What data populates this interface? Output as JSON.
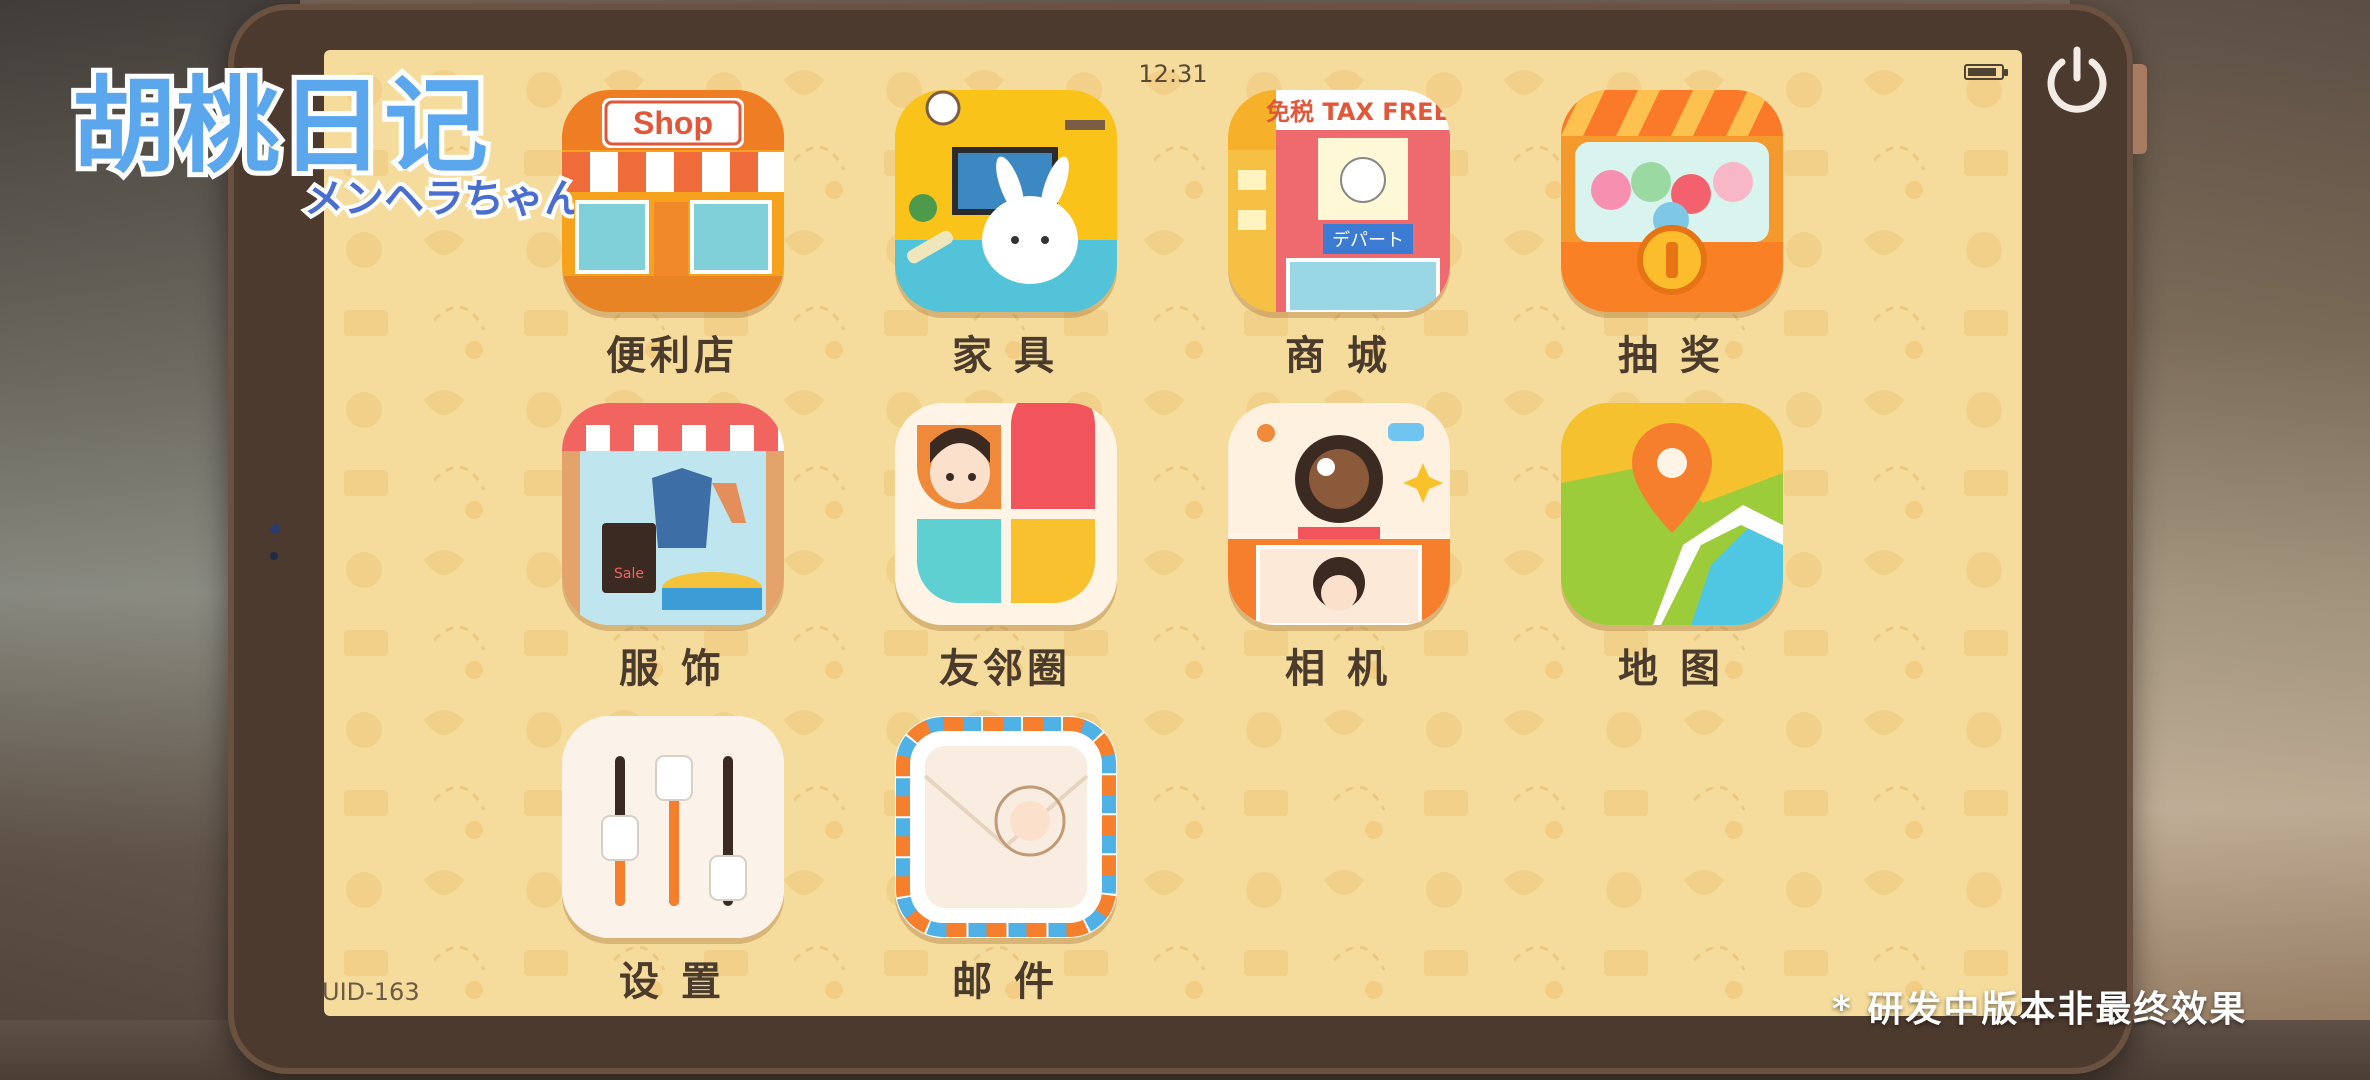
{
  "game": {
    "logo_title": "胡桃日记",
    "logo_subtitle": "メンヘラちゃん"
  },
  "status_bar": {
    "time": "12:31"
  },
  "uid": "UID-163",
  "apps": [
    {
      "label": "便利店",
      "icon": "convenience-store-icon",
      "sign": "Shop"
    },
    {
      "label": "家 具",
      "icon": "furniture-icon"
    },
    {
      "label": "商 城",
      "icon": "mall-icon",
      "sign": "免税 TAX FREE",
      "sign2": "デパート"
    },
    {
      "label": "抽 奖",
      "icon": "lottery-capsule-machine-icon"
    },
    {
      "label": "服 饰",
      "icon": "clothing-store-icon",
      "sign": "Sale"
    },
    {
      "label": "友邻圈",
      "icon": "friends-circle-icon"
    },
    {
      "label": "相 机",
      "icon": "camera-icon"
    },
    {
      "label": "地 图",
      "icon": "map-pin-icon"
    },
    {
      "label": "设 置",
      "icon": "settings-sliders-icon"
    },
    {
      "label": "邮 件",
      "icon": "mail-envelope-icon"
    }
  ],
  "footnote": "* 研发中版本非最终效果",
  "colors": {
    "screen_bg": "#f6dc9c",
    "tablet_frame": "#6a5140",
    "label_text": "#4a3b2c"
  }
}
